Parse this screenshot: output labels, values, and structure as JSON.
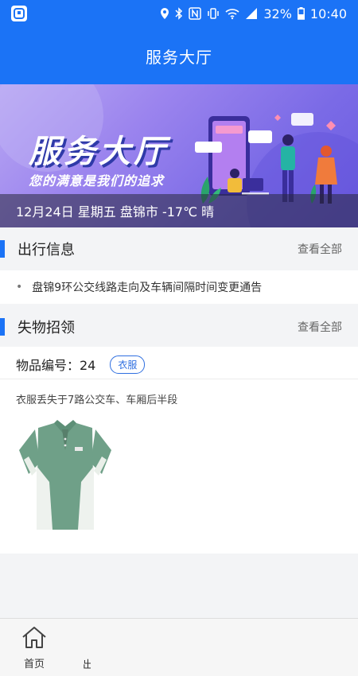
{
  "status_bar": {
    "battery": "32%",
    "time": "10:40",
    "icons": [
      "app-icon",
      "location-icon",
      "bluetooth-icon",
      "nfc-icon",
      "vibrate-icon",
      "wifi-icon",
      "signal-icon",
      "battery-icon"
    ]
  },
  "header": {
    "title": "服务大厅"
  },
  "banner": {
    "title": "服务大厅",
    "slogan": "您的满意是我们的追求",
    "info": "12月24日 星期五 盘锦市 -17℃ 晴"
  },
  "travel_section": {
    "title": "出行信息",
    "more": "查看全部",
    "items": [
      "盘锦9环公交线路走向及车辆间隔时间变更通告"
    ]
  },
  "lost_section": {
    "title": "失物招领",
    "more": "查看全部",
    "item": {
      "number": "物品编号：24",
      "tag": "衣服",
      "description": "衣服丢失于7路公交车、车厢后半段",
      "image_label": "polo-shirt"
    }
  },
  "bottom_nav": {
    "home_label": "首页",
    "partial_label": "出"
  },
  "colors": {
    "primary": "#1b73f6",
    "tag": "#2f6fe0",
    "banner": "#8b78ec"
  }
}
